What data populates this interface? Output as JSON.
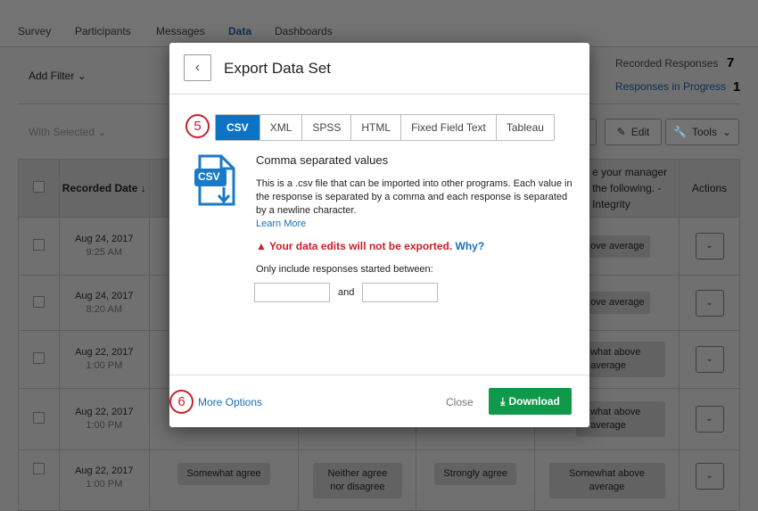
{
  "nav": {
    "tabs": [
      "Survey",
      "Participants",
      "Messages",
      "Data",
      "Dashboards"
    ],
    "active": "Data"
  },
  "toolbar": {
    "add_filter": "Add Filter",
    "with_selected": "With Selected",
    "edit": "Edit",
    "tools": "Tools"
  },
  "stats": {
    "recorded_label": "Recorded Responses",
    "recorded_value": "7",
    "progress_label": "Responses in Progress",
    "progress_value": "1"
  },
  "table": {
    "headers": {
      "date": "Recorded Date",
      "question": "e your manager the following. - Integrity",
      "actions": "Actions"
    },
    "rows": [
      {
        "date": "Aug 24, 2017",
        "time": "9:25 AM",
        "c1": "",
        "c2": "",
        "c3": "",
        "c4": "ove average"
      },
      {
        "date": "Aug 24, 2017",
        "time": "8:20 AM",
        "c1": "",
        "c2": "",
        "c3": "",
        "c4": "ove average"
      },
      {
        "date": "Aug 22, 2017",
        "time": "1:00 PM",
        "c1": "",
        "c2": "",
        "c3": "",
        "c4": "what above average"
      },
      {
        "date": "Aug 22, 2017",
        "time": "1:00 PM",
        "c1": "",
        "c2": "",
        "c3": "",
        "c4": "what above average"
      },
      {
        "date": "Aug 22, 2017",
        "time": "1:00 PM",
        "c1": "Somewhat agree",
        "c2": "Neither agree nor disagree",
        "c3": "Strongly agree",
        "c4": "Somewhat above average"
      }
    ]
  },
  "modal": {
    "title": "Export Data Set",
    "step5": "5",
    "step6": "6",
    "formats": [
      "CSV",
      "XML",
      "SPSS",
      "HTML",
      "Fixed Field Text",
      "Tableau"
    ],
    "selected_format": "CSV",
    "icon_label": "CSV",
    "format_title": "Comma separated values",
    "description": "This is a .csv file that can be imported into other programs. Each value in the response is separated by a comma and each response is separated by a newline character.",
    "learn_more": "Learn More",
    "warning": "Your data edits will not be exported.",
    "why": "Why?",
    "range_label": "Only include responses started between:",
    "and": "and",
    "start_value": "",
    "end_value": "",
    "more_options": "More Options",
    "close": "Close",
    "download": "Download"
  },
  "colors": {
    "accent": "#0b72c4",
    "download": "#0f9a4b",
    "warning": "#c8202b"
  }
}
